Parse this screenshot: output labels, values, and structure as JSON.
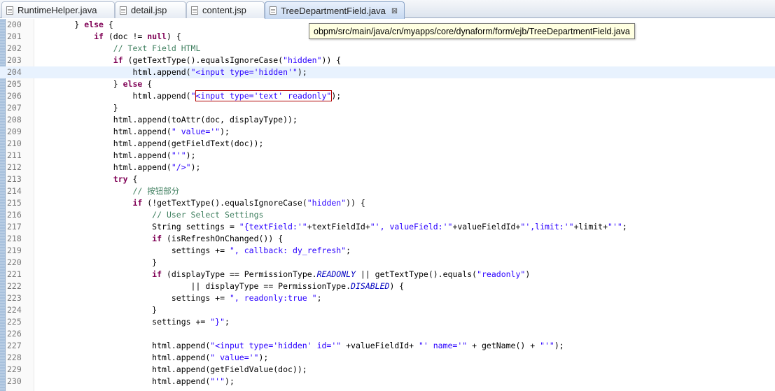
{
  "tabs": [
    {
      "label": "RuntimeHelper.java",
      "icon": "java-file-icon"
    },
    {
      "label": "detail.jsp",
      "icon": "jsp-file-icon"
    },
    {
      "label": "content.jsp",
      "icon": "jsp-file-icon"
    },
    {
      "label": "TreeDepartmentField.java",
      "icon": "java-file-icon",
      "active": true,
      "close": "⊠"
    }
  ],
  "tooltip": "obpm/src/main/java/cn/myapps/core/dynaform/form/ejb/TreeDepartmentField.java",
  "current_line": 204,
  "colors": {
    "keyword": "#7f0055",
    "string": "#2a00ff",
    "comment": "#3f7f5f",
    "constant": "#0000c0",
    "current_line": "#e8f2fe",
    "highlight_box": "#b00000"
  },
  "lines": [
    {
      "n": "200",
      "tokens": [
        [
          "t",
          "        } "
        ],
        [
          "kw",
          "else"
        ],
        [
          "t",
          " {"
        ]
      ]
    },
    {
      "n": "201",
      "tokens": [
        [
          "t",
          "            "
        ],
        [
          "kw",
          "if"
        ],
        [
          "t",
          " (doc != "
        ],
        [
          "kw",
          "null"
        ],
        [
          "t",
          ") {"
        ]
      ]
    },
    {
      "n": "202",
      "tokens": [
        [
          "t",
          "                "
        ],
        [
          "cm",
          "// Text Field HTML"
        ]
      ]
    },
    {
      "n": "203",
      "tokens": [
        [
          "t",
          "                "
        ],
        [
          "kw",
          "if"
        ],
        [
          "t",
          " (getTextType().equalsIgnoreCase("
        ],
        [
          "str",
          "\"hidden\""
        ],
        [
          "t",
          ")) {"
        ]
      ]
    },
    {
      "n": "204",
      "tokens": [
        [
          "t",
          "                    html.append("
        ],
        [
          "str",
          "\"<input type='hidden'\""
        ],
        [
          "t",
          ");"
        ]
      ]
    },
    {
      "n": "205",
      "tokens": [
        [
          "t",
          "                } "
        ],
        [
          "kw",
          "else"
        ],
        [
          "t",
          " {"
        ]
      ]
    },
    {
      "n": "206",
      "tokens": [
        [
          "t",
          "                    html.append("
        ],
        [
          "str",
          "\""
        ],
        [
          "hl",
          "<input type='text' readonly\""
        ],
        [
          "t",
          ");"
        ]
      ]
    },
    {
      "n": "207",
      "tokens": [
        [
          "t",
          "                }"
        ]
      ]
    },
    {
      "n": "208",
      "tokens": [
        [
          "t",
          "                html.append(toAttr(doc, displayType));"
        ]
      ]
    },
    {
      "n": "209",
      "tokens": [
        [
          "t",
          "                html.append("
        ],
        [
          "str",
          "\" value='\""
        ],
        [
          "t",
          ");"
        ]
      ]
    },
    {
      "n": "210",
      "tokens": [
        [
          "t",
          "                html.append(getFieldText(doc));"
        ]
      ]
    },
    {
      "n": "211",
      "tokens": [
        [
          "t",
          "                html.append("
        ],
        [
          "str",
          "\"'\""
        ],
        [
          "t",
          ");"
        ]
      ]
    },
    {
      "n": "212",
      "tokens": [
        [
          "t",
          "                html.append("
        ],
        [
          "str",
          "\"/>\""
        ],
        [
          "t",
          ");"
        ]
      ]
    },
    {
      "n": "213",
      "tokens": [
        [
          "t",
          "                "
        ],
        [
          "kw",
          "try"
        ],
        [
          "t",
          " {"
        ]
      ]
    },
    {
      "n": "214",
      "tokens": [
        [
          "t",
          "                    "
        ],
        [
          "cm",
          "// "
        ],
        [
          "cmcjk",
          "按钮部分"
        ]
      ]
    },
    {
      "n": "215",
      "tokens": [
        [
          "t",
          "                    "
        ],
        [
          "kw",
          "if"
        ],
        [
          "t",
          " (!getTextType().equalsIgnoreCase("
        ],
        [
          "str",
          "\"hidden\""
        ],
        [
          "t",
          ")) {"
        ]
      ]
    },
    {
      "n": "216",
      "tokens": [
        [
          "t",
          "                        "
        ],
        [
          "cm",
          "// User Select Settings"
        ]
      ]
    },
    {
      "n": "217",
      "tokens": [
        [
          "t",
          "                        String settings = "
        ],
        [
          "str",
          "\"{textField:'\""
        ],
        [
          "t",
          "+textFieldId+"
        ],
        [
          "str",
          "\"', valueField:'\""
        ],
        [
          "t",
          "+valueFieldId+"
        ],
        [
          "str",
          "\"',limit:'\""
        ],
        [
          "t",
          "+limit+"
        ],
        [
          "str",
          "\"'\""
        ],
        [
          "t",
          ";"
        ]
      ]
    },
    {
      "n": "218",
      "tokens": [
        [
          "t",
          "                        "
        ],
        [
          "kw",
          "if"
        ],
        [
          "t",
          " (isRefreshOnChanged()) {"
        ]
      ]
    },
    {
      "n": "219",
      "tokens": [
        [
          "t",
          "                            settings += "
        ],
        [
          "str",
          "\", callback: dy_refresh\""
        ],
        [
          "t",
          ";"
        ]
      ]
    },
    {
      "n": "220",
      "tokens": [
        [
          "t",
          "                        }"
        ]
      ]
    },
    {
      "n": "221",
      "tokens": [
        [
          "t",
          "                        "
        ],
        [
          "kw",
          "if"
        ],
        [
          "t",
          " (displayType == PermissionType."
        ],
        [
          "const",
          "READONLY"
        ],
        [
          "t",
          " || getTextType().equals("
        ],
        [
          "str",
          "\"readonly\""
        ],
        [
          "t",
          ")"
        ]
      ]
    },
    {
      "n": "222",
      "tokens": [
        [
          "t",
          "                                || displayType == PermissionType."
        ],
        [
          "const",
          "DISABLED"
        ],
        [
          "t",
          ") {"
        ]
      ]
    },
    {
      "n": "223",
      "tokens": [
        [
          "t",
          "                            settings += "
        ],
        [
          "str",
          "\", readonly:true \""
        ],
        [
          "t",
          ";"
        ]
      ]
    },
    {
      "n": "224",
      "tokens": [
        [
          "t",
          "                        }"
        ]
      ]
    },
    {
      "n": "225",
      "tokens": [
        [
          "t",
          "                        settings += "
        ],
        [
          "str",
          "\"}\""
        ],
        [
          "t",
          ";"
        ]
      ]
    },
    {
      "n": "226",
      "tokens": []
    },
    {
      "n": "227",
      "tokens": [
        [
          "t",
          "                        html.append("
        ],
        [
          "str",
          "\"<input type='hidden' id='\""
        ],
        [
          "t",
          " +valueFieldId+ "
        ],
        [
          "str",
          "\"' name='\""
        ],
        [
          "t",
          " + getName() + "
        ],
        [
          "str",
          "\"'\""
        ],
        [
          "t",
          ");"
        ]
      ]
    },
    {
      "n": "228",
      "tokens": [
        [
          "t",
          "                        html.append("
        ],
        [
          "str",
          "\" value='\""
        ],
        [
          "t",
          ");"
        ]
      ]
    },
    {
      "n": "229",
      "tokens": [
        [
          "t",
          "                        html.append(getFieldValue(doc));"
        ]
      ]
    },
    {
      "n": "230",
      "tokens": [
        [
          "t",
          "                        html.append("
        ],
        [
          "str",
          "\"'\""
        ],
        [
          "t",
          ");"
        ]
      ]
    }
  ]
}
